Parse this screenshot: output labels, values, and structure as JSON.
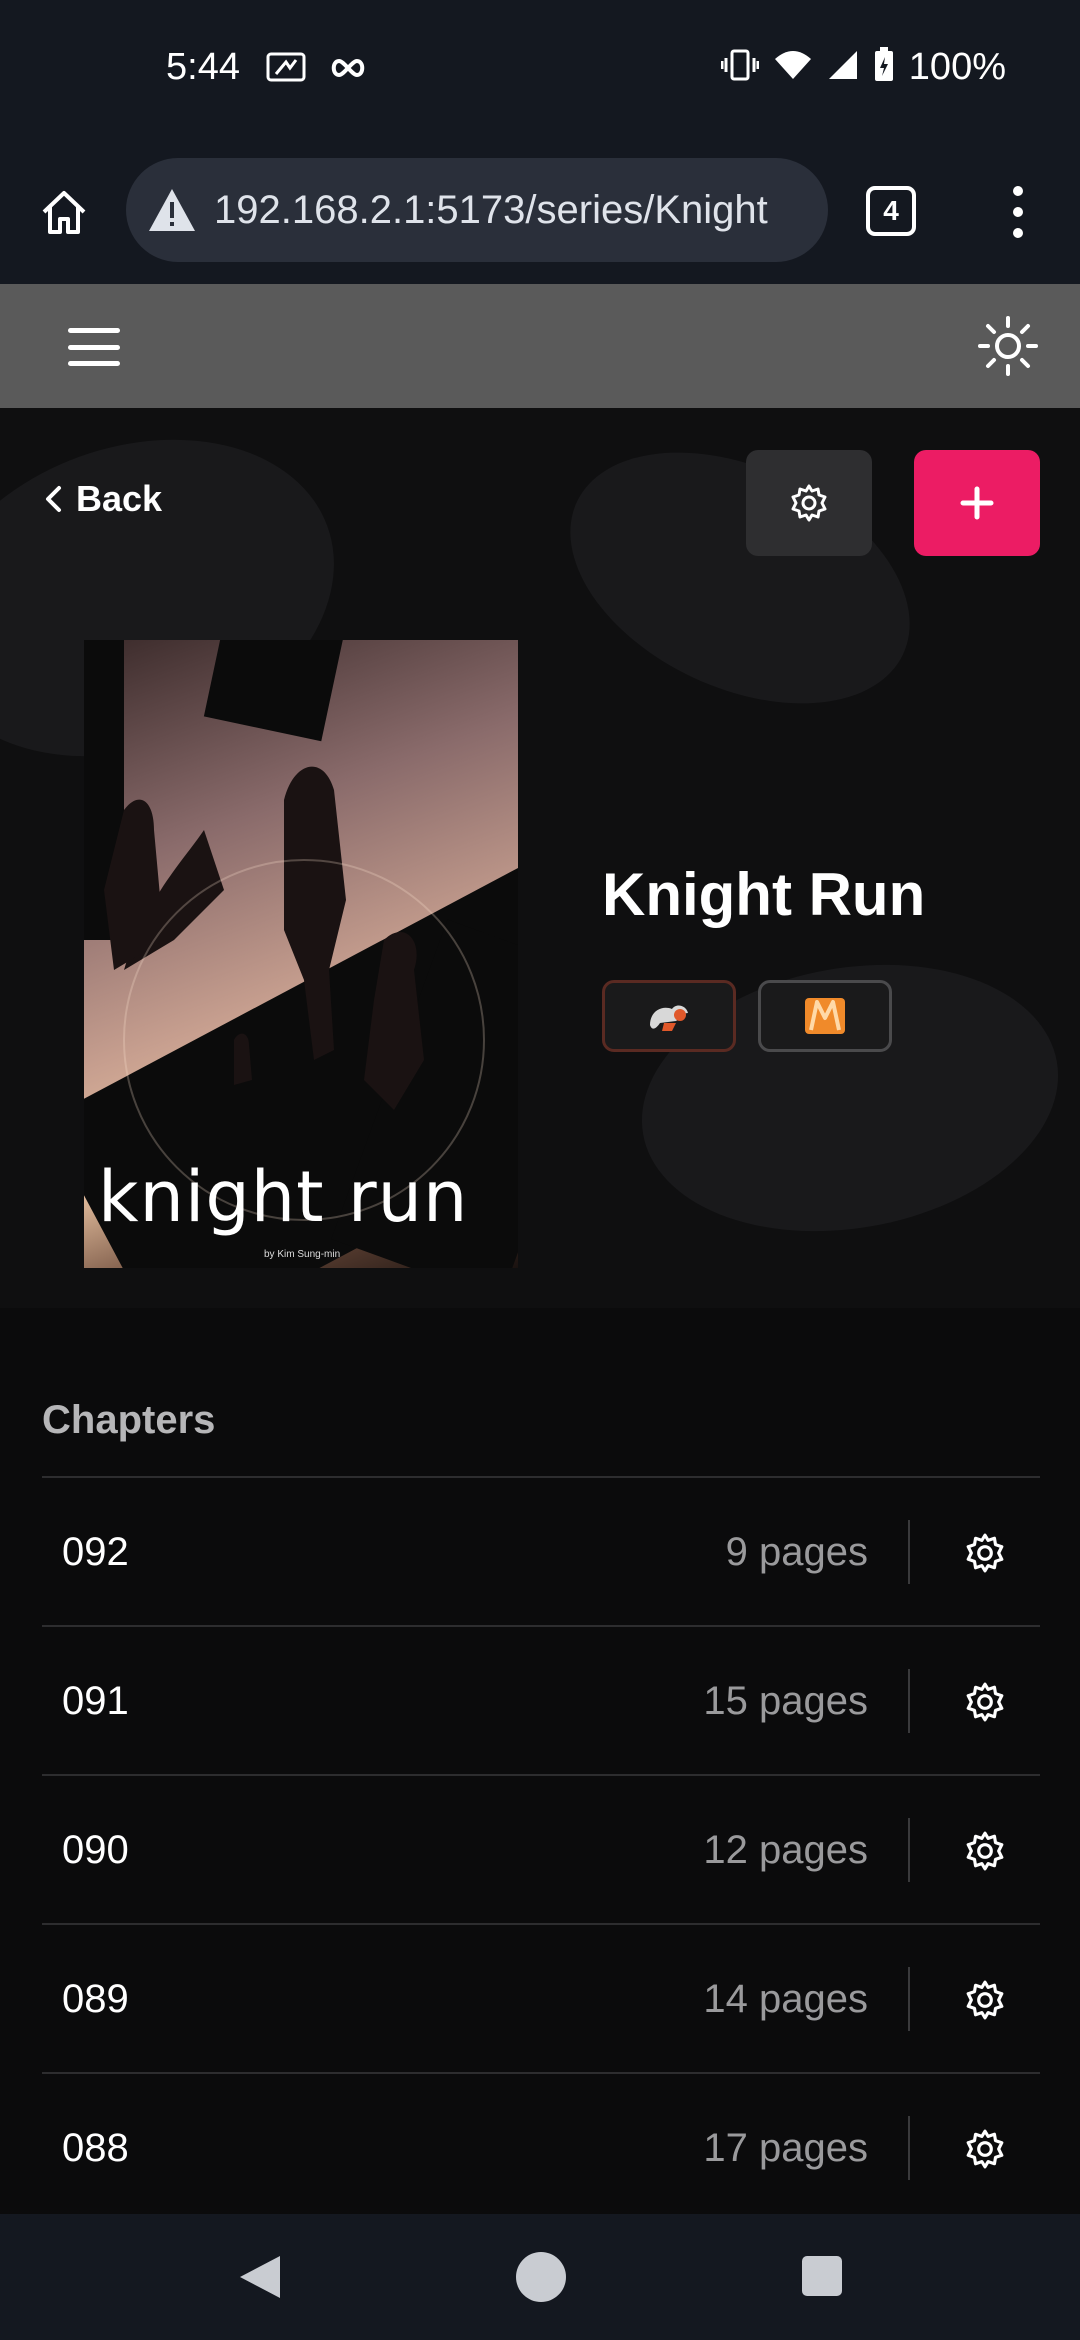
{
  "status_bar": {
    "time": "5:44",
    "battery": "100%",
    "icons_left": [
      "screen-cast-icon",
      "infinity-icon"
    ],
    "icons_right": [
      "vibrate-icon",
      "wifi-icon",
      "signal-icon",
      "battery-charging-icon"
    ]
  },
  "browser": {
    "url": "192.168.2.1:5173/series/Knight",
    "tab_count": "4",
    "security": "not-secure-warning-icon"
  },
  "header": {
    "menu_icon": "hamburger-icon",
    "theme_icon": "sun-icon"
  },
  "hero": {
    "back_label": "Back",
    "cover_title": "knight run",
    "cover_credit": "by Kim Sung-min",
    "title": "Knight Run",
    "sources": [
      "source-badge-1",
      "source-badge-2"
    ],
    "accent": "#ec1c64"
  },
  "chapters": {
    "heading": "Chapters",
    "items": [
      {
        "number": "092",
        "pages": "9 pages"
      },
      {
        "number": "091",
        "pages": "15 pages"
      },
      {
        "number": "090",
        "pages": "12 pages"
      },
      {
        "number": "089",
        "pages": "14 pages"
      },
      {
        "number": "088",
        "pages": "17 pages"
      }
    ]
  }
}
